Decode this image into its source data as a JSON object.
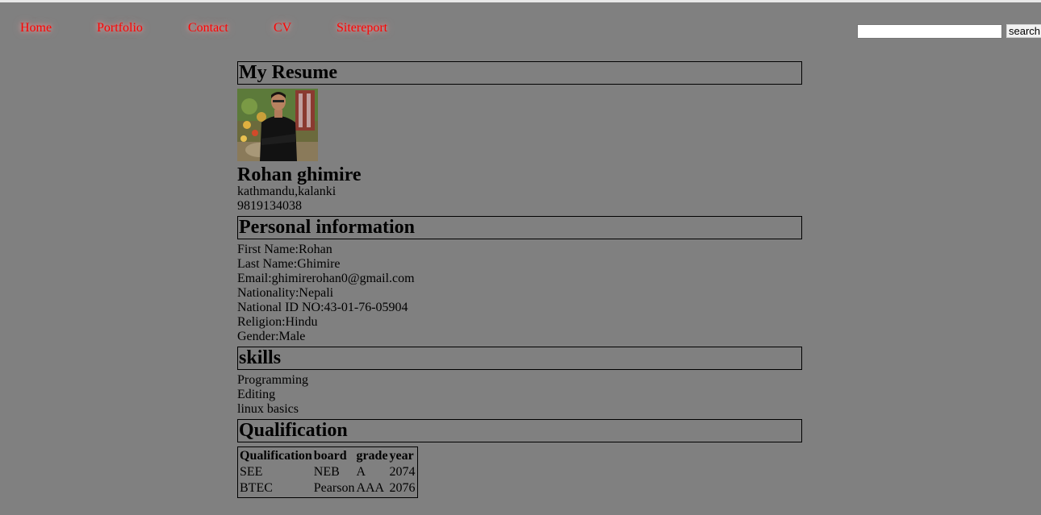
{
  "nav": {
    "items": [
      {
        "label": "Home"
      },
      {
        "label": "Portfolio"
      },
      {
        "label": "Contact"
      },
      {
        "label": "CV"
      },
      {
        "label": "Sitereport"
      }
    ]
  },
  "search": {
    "value": "",
    "button_label": "search"
  },
  "resume": {
    "title": "My Resume",
    "name": "Rohan ghimire",
    "address": "kathmandu,kalanki",
    "phone": "9819134038"
  },
  "personal": {
    "heading": "Personal information",
    "lines": [
      "First Name:Rohan",
      "Last Name:Ghimire",
      "Email:ghimirerohan0@gmail.com",
      "Nationality:Nepali",
      "National ID NO:43-01-76-05904",
      "Religion:Hindu",
      "Gender:Male"
    ]
  },
  "skills": {
    "heading": "skills",
    "items": [
      "Programming",
      "Editing",
      "linux basics"
    ]
  },
  "qualification": {
    "heading": "Qualification",
    "columns": [
      "Qualification",
      "board",
      "grade",
      "year"
    ],
    "rows": [
      [
        "SEE",
        "NEB",
        "A",
        "2074"
      ],
      [
        "BTEC",
        "Pearson",
        "AAA",
        "2076"
      ]
    ]
  },
  "colors": {
    "background": "#808080",
    "nav_link": "#ff0000"
  }
}
